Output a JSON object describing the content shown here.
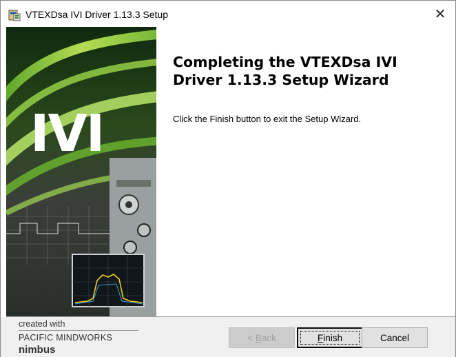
{
  "window": {
    "title": "VTEXDsa IVI Driver 1.13.3 Setup",
    "close_symbol": "✕"
  },
  "banner": {
    "logo_text": "IVI"
  },
  "content": {
    "heading": "Completing the VTEXDsa IVI Driver 1.13.3 Setup Wizard",
    "description": "Click the Finish button to exit the Setup Wizard."
  },
  "footer": {
    "brand_line1": "created with",
    "brand_line2": "PACIFIC MINDWORKS",
    "brand_line3": "nimbus",
    "back_label_prefix": "< ",
    "back_label_mnemonic": "B",
    "back_label_rest": "ack",
    "finish_label_mnemonic": "F",
    "finish_label_rest": "inish",
    "cancel_label": "Cancel"
  },
  "icons": {
    "app": "installer-icon",
    "close": "close-icon"
  }
}
